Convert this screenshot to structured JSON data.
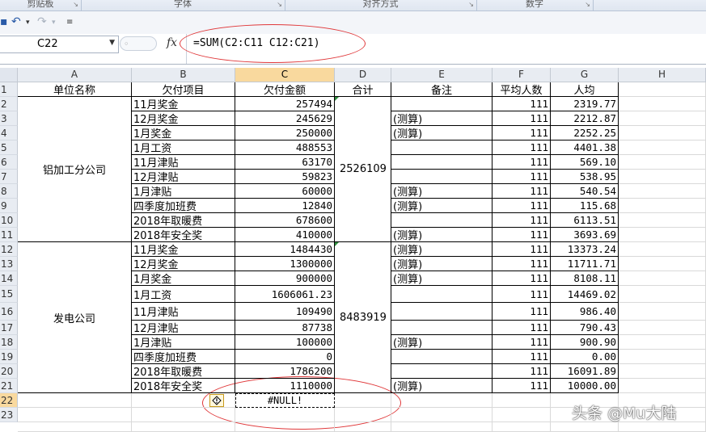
{
  "ribbon": {
    "groups": [
      "剪贴板",
      "字体",
      "对齐方式",
      "数字"
    ]
  },
  "name_box": {
    "value": "C22"
  },
  "formula_bar": {
    "fx_label": "fx",
    "formula": "=SUM(C2:C11 C12:C21)"
  },
  "columns": [
    "A",
    "B",
    "C",
    "D",
    "E",
    "F",
    "G",
    "H"
  ],
  "rows": [
    "1",
    "2",
    "3",
    "4",
    "5",
    "6",
    "7",
    "8",
    "9",
    "10",
    "11",
    "12",
    "13",
    "14",
    "15",
    "16",
    "17",
    "18",
    "19",
    "20",
    "21",
    "22",
    "23"
  ],
  "headers": {
    "A": "单位名称",
    "B": "欠付项目",
    "C": "欠付金额",
    "D": "合计",
    "E": "备注",
    "F": "平均人数",
    "G": "人均"
  },
  "groups": [
    {
      "name": "铝加工分公司",
      "total": "2526109"
    },
    {
      "name": "发电公司",
      "total": "8483919"
    }
  ],
  "data_rows": [
    {
      "item": "11月奖金",
      "amount": "257494",
      "note": "",
      "avg": "111",
      "per": "2319.77"
    },
    {
      "item": "12月奖金",
      "amount": "245629",
      "note": "(测算)",
      "avg": "111",
      "per": "2212.87"
    },
    {
      "item": "1月奖金",
      "amount": "250000",
      "note": "(测算)",
      "avg": "111",
      "per": "2252.25"
    },
    {
      "item": "1月工资",
      "amount": "488553",
      "note": "",
      "avg": "111",
      "per": "4401.38"
    },
    {
      "item": "11月津贴",
      "amount": "63170",
      "note": "",
      "avg": "111",
      "per": "569.10"
    },
    {
      "item": "12月津贴",
      "amount": "59823",
      "note": "",
      "avg": "111",
      "per": "538.95"
    },
    {
      "item": "1月津贴",
      "amount": "60000",
      "note": "(测算)",
      "avg": "111",
      "per": "540.54"
    },
    {
      "item": "四季度加班费",
      "amount": "12840",
      "note": "(测算)",
      "avg": "111",
      "per": "115.68"
    },
    {
      "item": "2018年取暖费",
      "amount": "678600",
      "note": "",
      "avg": "111",
      "per": "6113.51"
    },
    {
      "item": "2018年安全奖",
      "amount": "410000",
      "note": "(测算)",
      "avg": "111",
      "per": "3693.69"
    },
    {
      "item": "11月奖金",
      "amount": "1484430",
      "note": "(测算)",
      "avg": "111",
      "per": "13373.24"
    },
    {
      "item": "12月奖金",
      "amount": "1300000",
      "note": "(测算)",
      "avg": "111",
      "per": "11711.71"
    },
    {
      "item": "1月奖金",
      "amount": "900000",
      "note": "(测算)",
      "avg": "111",
      "per": "8108.11"
    },
    {
      "item": "1月工资",
      "amount": "1606061.23",
      "note": "",
      "avg": "111",
      "per": "14469.02"
    },
    {
      "item": "11月津贴",
      "amount": "109490",
      "note": "",
      "avg": "111",
      "per": "986.40"
    },
    {
      "item": "12月津贴",
      "amount": "87738",
      "note": "",
      "avg": "111",
      "per": "790.43"
    },
    {
      "item": "1月津贴",
      "amount": "100000",
      "note": "(测算)",
      "avg": "111",
      "per": "900.90"
    },
    {
      "item": "四季度加班费",
      "amount": "0",
      "note": "",
      "avg": "111",
      "per": "0.00"
    },
    {
      "item": "2018年取暖费",
      "amount": "1786200",
      "note": "",
      "avg": "111",
      "per": "16091.89"
    },
    {
      "item": "2018年安全奖",
      "amount": "1110000",
      "note": "(测算)",
      "avg": "111",
      "per": "10000.00"
    }
  ],
  "error_cell": {
    "value": "#NULL!"
  },
  "watermark": "头条 @Mu大陆",
  "colors": {
    "annotation": "#e0383a",
    "selected_header": "#f9d99e",
    "warning": "#c79a1b"
  }
}
